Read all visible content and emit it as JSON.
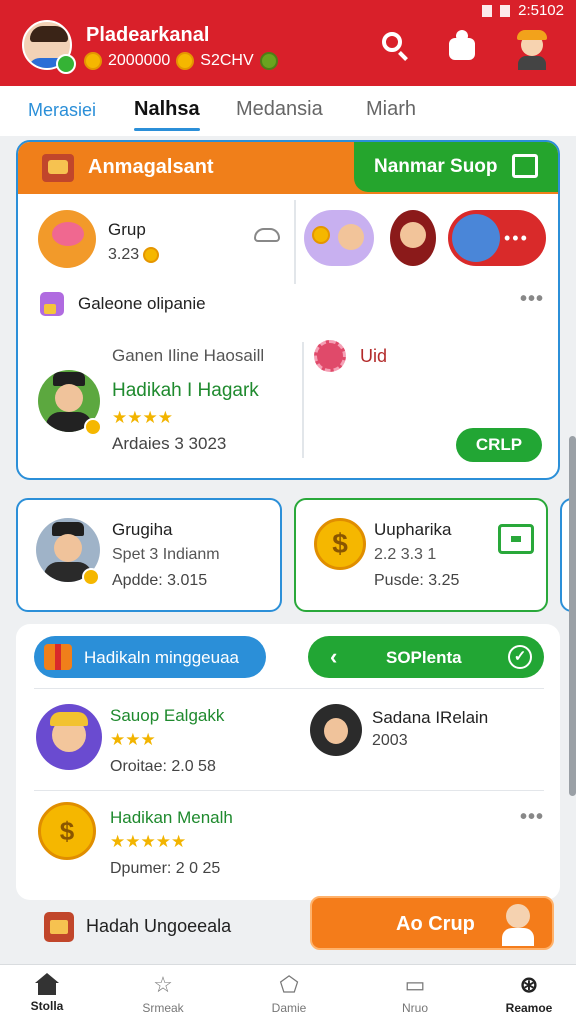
{
  "status_bar": {
    "time": "2:5102"
  },
  "header": {
    "user_name": "Pladearkanal",
    "coins_primary": "2000000",
    "coins_secondary": "S2CHV"
  },
  "tabs": [
    {
      "label": "Merasiei"
    },
    {
      "label": "Nalhsa"
    },
    {
      "label": "Medansia"
    },
    {
      "label": "Miarh"
    }
  ],
  "main_panel": {
    "title": "Anmagalsant",
    "action_label": "Nanmar Suop",
    "group": {
      "name": "Grup",
      "value": "3.23"
    },
    "friends_more": "•••",
    "gallery_title": "Galeone olipanie",
    "host": {
      "subtitle": "Ganen Iline Haosaill",
      "name": "Hadikah I Hagark",
      "stars": "★★★★",
      "meta": "Ardaies 3 3023"
    },
    "uid_label": "Uid",
    "crlp_label": "CRLP"
  },
  "cards": [
    {
      "title": "Grugiha",
      "subtitle": "Spet 3 Indianm",
      "meta": "Apdde: 3.015"
    },
    {
      "title": "Uupharika",
      "subtitle": "2.2 3.3 1",
      "meta": "Pusde: 3.25",
      "coin_glyph": "$"
    }
  ],
  "lower_panel": {
    "chip_left": "Hadikaln minggeuaa",
    "chip_right": "SOPlenta",
    "items": [
      {
        "title": "Sauop Ealgakk",
        "stars": "★★★",
        "meta": "Oroitae: 2.0 58"
      },
      {
        "title": "Sadana IRelain",
        "meta": "2003"
      },
      {
        "title": "Hadikan Menalh",
        "stars": "★★★★★",
        "meta": "Dpumer: 2 0 25",
        "coin_glyph": "$"
      }
    ]
  },
  "bottom_strip": {
    "label": "Hadah Ungoeeala",
    "button": "Ao Crup"
  },
  "nav": [
    {
      "label": "Stolla",
      "icon": "home-icon"
    },
    {
      "label": "Srmeak",
      "icon": "star-icon"
    },
    {
      "label": "Damie",
      "icon": "shield-icon"
    },
    {
      "label": "Nruo",
      "icon": "screen-icon"
    },
    {
      "label": "Reamoe",
      "icon": "game-icon"
    }
  ],
  "colors": {
    "header_red": "#d9202a",
    "accent_blue": "#2b8fd8",
    "accent_green": "#22a634",
    "accent_orange": "#f07f1a"
  }
}
